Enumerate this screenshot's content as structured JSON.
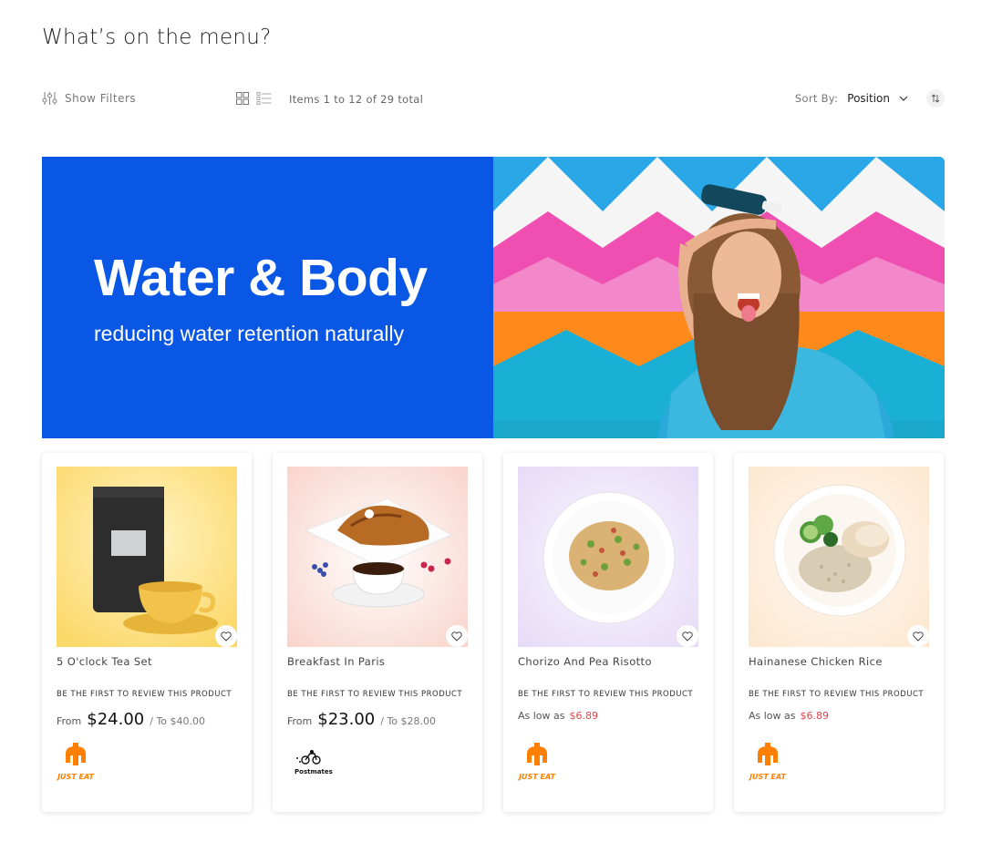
{
  "page": {
    "title": "What’s on the menu?"
  },
  "toolbar": {
    "filters_label": "Show Filters",
    "amount_text": "Items 1 to 12 of 29 total",
    "sort_label": "Sort By:",
    "sort_value": "Position",
    "view_modes": [
      "grid-icon",
      "list-icon"
    ]
  },
  "banner": {
    "title": "Water & Body",
    "subtitle": "reducing water retention naturally",
    "background_color": "#0a57e6"
  },
  "review_prompt": "BE THE FIRST TO REVIEW THIS PRODUCT",
  "products": [
    {
      "name": "5 O'clock Tea Set",
      "price_prefix": "From",
      "price": "$24.00",
      "price_to": "/ To $40.00",
      "partner": "JUST EAT"
    },
    {
      "name": "Breakfast In Paris",
      "price_prefix": "From",
      "price": "$23.00",
      "price_to": "/ To $28.00",
      "partner": "Postmates"
    },
    {
      "name": "Chorizo And Pea Risotto",
      "price_prefix": "As low as",
      "price": "$6.89",
      "partner": "JUST EAT"
    },
    {
      "name": "Hainanese Chicken Rice",
      "price_prefix": "As low as",
      "price": "$6.89",
      "partner": "JUST EAT"
    }
  ],
  "colors": {
    "accent_price": "#e0454b",
    "just_eat": "#ff8000",
    "banner_blue": "#0a57e6"
  }
}
